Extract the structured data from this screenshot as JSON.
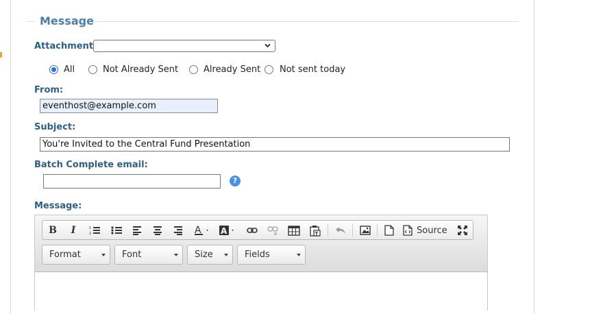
{
  "section": {
    "legend": "Message"
  },
  "attachment": {
    "label": "Attachment:",
    "value": ""
  },
  "filters": [
    {
      "label": "All",
      "checked": true
    },
    {
      "label": "Not Already Sent",
      "checked": false
    },
    {
      "label": "Already Sent",
      "checked": false
    },
    {
      "label": "Not sent today",
      "checked": false
    }
  ],
  "from": {
    "label": "From:",
    "value": "eventhost@example.com"
  },
  "subject": {
    "label": "Subject:",
    "value": "You're Invited to the Central Fund Presentation"
  },
  "batch": {
    "label": "Batch Complete email:",
    "value": "",
    "help_icon": "?"
  },
  "message": {
    "label": "Message:"
  },
  "toolbar": {
    "bold": "B",
    "italic": "I",
    "source_label": "Source",
    "icons": [
      "bold-icon",
      "italic-icon",
      "numbered-list-icon",
      "bulleted-list-icon",
      "align-left-icon",
      "align-center-icon",
      "align-right-icon",
      "text-color-icon",
      "background-color-icon",
      "link-icon",
      "unlink-icon",
      "table-icon",
      "paste-icon",
      "undo-icon",
      "image-icon",
      "new-page-icon",
      "source-icon",
      "maximize-icon"
    ],
    "combos": {
      "format": "Format",
      "font": "Font",
      "size": "Size",
      "fields": "Fields"
    }
  },
  "colors": {
    "accent": "#4b7fa8",
    "label": "#2f5f86",
    "input_highlight": "#e8f0fe",
    "help": "#4a90e2"
  }
}
